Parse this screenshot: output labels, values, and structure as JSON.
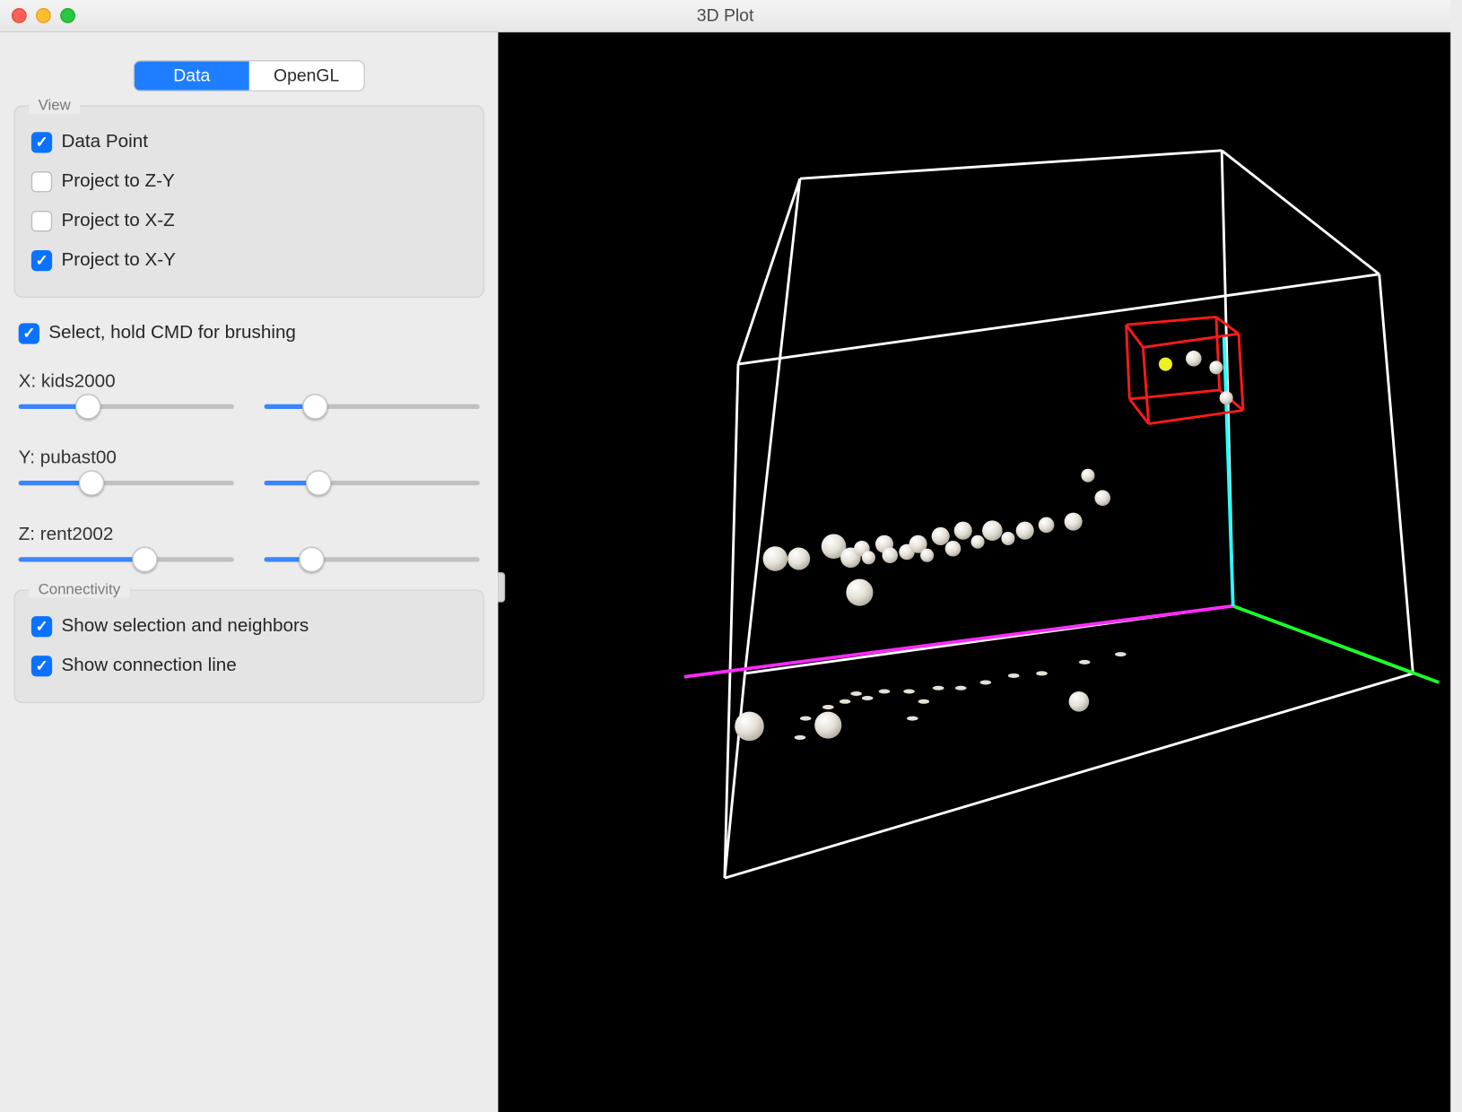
{
  "window": {
    "title": "3D Plot"
  },
  "tabs": [
    {
      "label": "Data",
      "active": true
    },
    {
      "label": "OpenGL",
      "active": false
    }
  ],
  "view": {
    "title": "View",
    "items": [
      {
        "label": "Data Point",
        "checked": true
      },
      {
        "label": "Project to Z-Y",
        "checked": false
      },
      {
        "label": "Project to X-Z",
        "checked": false
      },
      {
        "label": "Project to X-Y",
        "checked": true
      }
    ]
  },
  "select": {
    "label": "Select, hold CMD for brushing",
    "checked": true
  },
  "sliders": {
    "x": {
      "label": "X: kids2000",
      "low": 30,
      "high": 20
    },
    "y": {
      "label": "Y: pubast00",
      "low": 32,
      "high": 22
    },
    "z": {
      "label": "Z: rent2002",
      "low": 60,
      "high": 18
    }
  },
  "connectivity": {
    "title": "Connectivity",
    "items": [
      {
        "label": "Show selection and neighbors",
        "checked": true
      },
      {
        "label": "Show connection line",
        "checked": true
      }
    ]
  },
  "plot": {
    "axes": {
      "x_var": "kids2000",
      "y_var": "pubast00",
      "z_var": "rent2002",
      "colors": {
        "x": "#ff2aff",
        "y": "#1aff2a",
        "z": "#2affff"
      }
    },
    "selection_box": {
      "present": true,
      "selected_point_count": 4
    },
    "projections": {
      "xy": true,
      "xz": false,
      "zy": false
    }
  },
  "chart_data": {
    "type": "scatter",
    "title": "3D Plot",
    "x": {
      "label": "kids2000",
      "range_fraction": [
        0.3,
        1.0
      ]
    },
    "y": {
      "label": "pubast00",
      "range_fraction": [
        0.32,
        1.0
      ]
    },
    "z": {
      "label": "rent2002",
      "range_fraction": [
        0.6,
        1.0
      ]
    },
    "note": "Axis numeric ranges are not shown on screen; values below are approximate unit-cube fractions read from the rendered positions.",
    "points_unit_cube": [
      {
        "id": 0,
        "x": 0.2,
        "y": 0.34,
        "z": 0.4,
        "selected": false
      },
      {
        "id": 1,
        "x": 0.22,
        "y": 0.36,
        "z": 0.4,
        "selected": false
      },
      {
        "id": 2,
        "x": 0.28,
        "y": 0.37,
        "z": 0.42,
        "selected": false
      },
      {
        "id": 3,
        "x": 0.3,
        "y": 0.36,
        "z": 0.43,
        "selected": false
      },
      {
        "id": 4,
        "x": 0.32,
        "y": 0.37,
        "z": 0.45,
        "selected": false
      },
      {
        "id": 5,
        "x": 0.33,
        "y": 0.38,
        "z": 0.44,
        "selected": false
      },
      {
        "id": 6,
        "x": 0.34,
        "y": 0.38,
        "z": 0.44,
        "selected": false
      },
      {
        "id": 7,
        "x": 0.31,
        "y": 0.35,
        "z": 0.42,
        "selected": false
      },
      {
        "id": 8,
        "x": 0.33,
        "y": 0.37,
        "z": 0.43,
        "selected": false
      },
      {
        "id": 9,
        "x": 0.35,
        "y": 0.4,
        "z": 0.46,
        "selected": false
      },
      {
        "id": 10,
        "x": 0.36,
        "y": 0.4,
        "z": 0.46,
        "selected": false
      },
      {
        "id": 11,
        "x": 0.38,
        "y": 0.4,
        "z": 0.45,
        "selected": false
      },
      {
        "id": 12,
        "x": 0.39,
        "y": 0.43,
        "z": 0.47,
        "selected": false
      },
      {
        "id": 13,
        "x": 0.4,
        "y": 0.44,
        "z": 0.47,
        "selected": false
      },
      {
        "id": 14,
        "x": 0.42,
        "y": 0.45,
        "z": 0.48,
        "selected": false
      },
      {
        "id": 15,
        "x": 0.43,
        "y": 0.42,
        "z": 0.46,
        "selected": false
      },
      {
        "id": 16,
        "x": 0.44,
        "y": 0.44,
        "z": 0.48,
        "selected": false
      },
      {
        "id": 17,
        "x": 0.46,
        "y": 0.46,
        "z": 0.49,
        "selected": false
      },
      {
        "id": 18,
        "x": 0.5,
        "y": 0.44,
        "z": 0.52,
        "selected": false
      },
      {
        "id": 19,
        "x": 0.52,
        "y": 0.5,
        "z": 0.5,
        "selected": false
      },
      {
        "id": 20,
        "x": 0.55,
        "y": 0.47,
        "z": 0.5,
        "selected": false
      },
      {
        "id": 21,
        "x": 0.58,
        "y": 0.5,
        "z": 0.55,
        "selected": false
      },
      {
        "id": 22,
        "x": 0.3,
        "y": 0.28,
        "z": 0.3,
        "selected": false
      },
      {
        "id": 23,
        "x": 0.15,
        "y": 0.1,
        "z": 0.12,
        "selected": false
      },
      {
        "id": 24,
        "x": 0.23,
        "y": 0.1,
        "z": 0.14,
        "selected": false
      },
      {
        "id": 25,
        "x": 0.56,
        "y": 0.05,
        "z": 0.16,
        "selected": false
      },
      {
        "id": 26,
        "x": 0.75,
        "y": 0.92,
        "z": 0.87,
        "selected": false
      },
      {
        "id": 27,
        "x": 0.79,
        "y": 0.93,
        "z": 0.86,
        "selected": false
      },
      {
        "id": 28,
        "x": 0.69,
        "y": 0.9,
        "z": 0.9,
        "selected": true
      },
      {
        "id": 29,
        "x": 0.84,
        "y": 0.87,
        "z": 0.83,
        "selected": false
      }
    ]
  }
}
